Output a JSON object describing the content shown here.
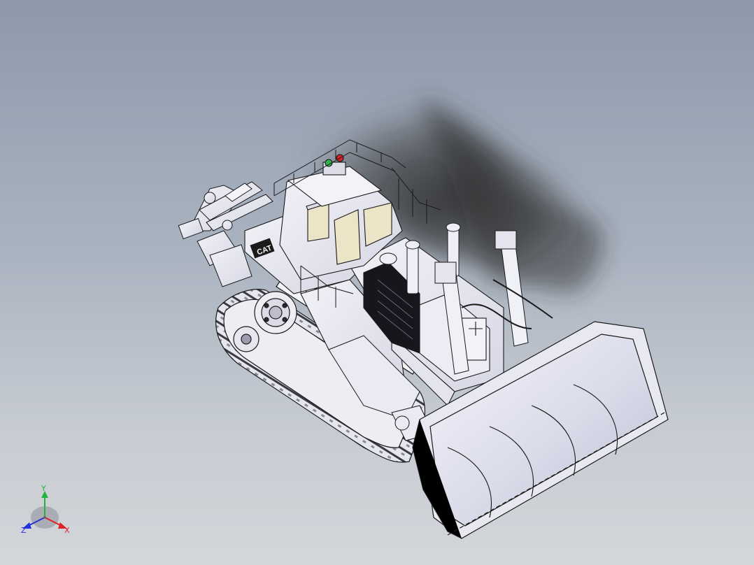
{
  "viewport": {
    "background_top": "#8d99ab",
    "background_bottom": "#d3d6da",
    "model": {
      "icon": "bulldozer-model",
      "logo_text": "CAT",
      "edge_color": "#1a1a1a",
      "body_color": "#ececf4",
      "window_color": "#ebe4c7",
      "indicator_green": "#2fb34a",
      "indicator_red": "#d8232a"
    }
  },
  "triad": {
    "icon": "coordinate-triad",
    "x_label": "X",
    "y_label": "Y",
    "z_label": "Z",
    "x_color": "#e0202a",
    "y_color": "#22b33a",
    "z_color": "#2233dd"
  }
}
